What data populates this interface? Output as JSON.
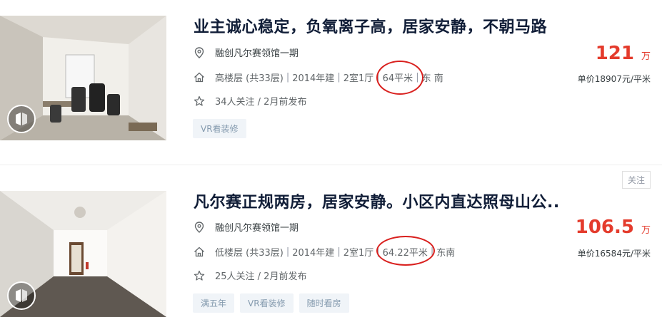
{
  "listings": [
    {
      "title": "业主诚心稳定，负氧离子高，居家安静，不朝马路",
      "community": "融创凡尔赛领馆一期",
      "floor": "高楼层 (共33层)",
      "year": "2014年建",
      "layout": "2室1厅",
      "area": "64平米",
      "orientation": "东 南",
      "follow_info": "34人关注 / 2月前发布",
      "tags": [
        "VR看装修"
      ],
      "price": "121",
      "price_unit": "万",
      "unit_price": "单价18907元/平米"
    },
    {
      "title": "凡尔赛正规两房，居家安静。小区内直达照母山公..",
      "community": "融创凡尔赛领馆一期",
      "floor": "低楼层 (共33层)",
      "year": "2014年建",
      "layout": "2室1厅",
      "area": "64.22平米",
      "orientation": "东南",
      "follow_info": "25人关注 / 2月前发布",
      "tags": [
        "满五年",
        "VR看装修",
        "随时看房"
      ],
      "price": "106.5",
      "price_unit": "万",
      "unit_price": "单价16584元/平米",
      "follow_button": "关注"
    }
  ],
  "separator": "|",
  "colors": {
    "price": "#e43b2c",
    "highlight_circle": "#d9201e",
    "tag_bg": "#f0f4f8",
    "tag_text": "#849aae"
  },
  "icons": [
    "location-pin-icon",
    "house-icon",
    "star-icon",
    "vr-icon"
  ]
}
